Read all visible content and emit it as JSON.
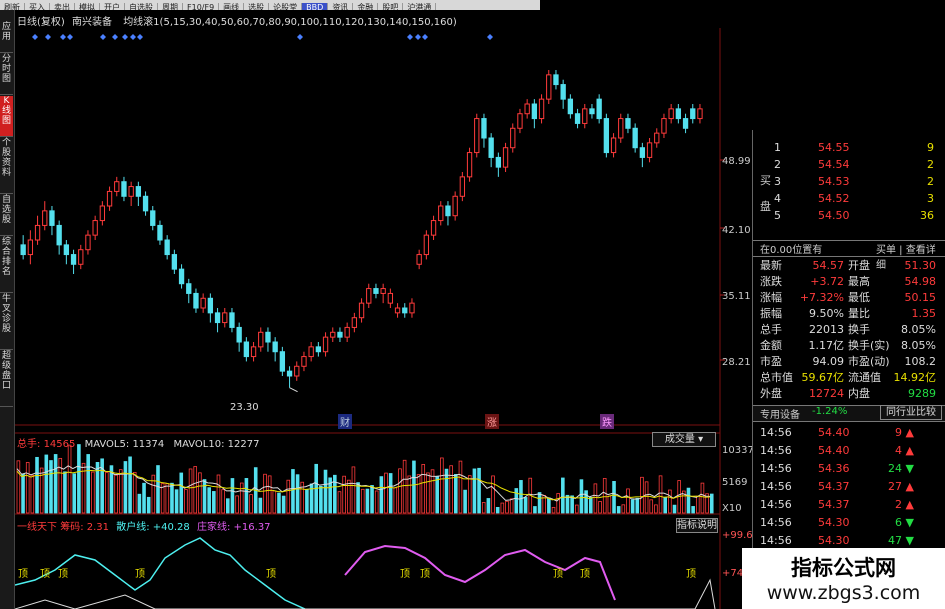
{
  "toolbar": {
    "items": [
      "刷新",
      "买入",
      "卖出",
      "模拟",
      "开户",
      "自选股",
      "周期",
      "F10/F9",
      "画线",
      "选股",
      "论股堂",
      "BBD",
      "资讯",
      "金融",
      "股吧",
      "沪港通"
    ],
    "highlight_index": 11
  },
  "sidebar": {
    "tabs": [
      "应用",
      "分时图",
      "K线图",
      "个股资料",
      "自选股",
      "综合排名",
      "牛叉诊股",
      "超级盘口"
    ],
    "active_index": 2
  },
  "chart_header": {
    "period_label": "日线(复权)",
    "stock_name": "南兴装备",
    "ma_label": "均线滚1(5,15,30,40,50,60,70,80,90,100,110,120,130,140,150,160)"
  },
  "price_axis": {
    "ticks": [
      "48.99",
      "42.10",
      "35.11",
      "28.21"
    ],
    "low_marker": "23.30"
  },
  "event_markers": [
    "财",
    "涨",
    "跌"
  ],
  "volume_header": {
    "total_label": "总手",
    "total_value": "14565",
    "mavol5_label": "MAVOL5",
    "mavol5_value": "11374",
    "mavol10_label": "MAVOL10",
    "mavol10_value": "12277",
    "dropdown": "成交量",
    "axis_ticks": [
      "10337",
      "5169",
      "X10"
    ]
  },
  "indicator_header": {
    "name": "一线天下",
    "chips_label": "筹码",
    "chips_value": "2.31",
    "retail_label": "散户线",
    "retail_value": "+40.28",
    "banker_label": "庄家线",
    "banker_value": "+16.37",
    "explain_button": "指标说明",
    "axis_ticks": [
      "+99.67",
      "+74.9"
    ],
    "signal_text": "顶"
  },
  "order_book": {
    "side_label_top": "买",
    "side_label_bottom": "盘",
    "rows": [
      {
        "level": "1",
        "price": "54.55",
        "vol": "9"
      },
      {
        "level": "2",
        "price": "54.54",
        "vol": "2"
      },
      {
        "level": "3",
        "price": "54.53",
        "vol": "2"
      },
      {
        "level": "4",
        "price": "54.52",
        "vol": "3"
      },
      {
        "level": "5",
        "price": "54.50",
        "vol": "36"
      }
    ]
  },
  "position_bar": {
    "position_text": "在0.00位置有",
    "buy_sell_link": "买单 | 查看详细"
  },
  "quote": {
    "rows": [
      {
        "l1": "最新",
        "v1": "54.57",
        "l2": "开盘",
        "v2": "51.30"
      },
      {
        "l1": "涨跌",
        "v1": "+3.72",
        "l2": "最高",
        "v2": "54.98"
      },
      {
        "l1": "涨幅",
        "v1": "+7.32%",
        "l2": "最低",
        "v2": "50.15"
      },
      {
        "l1": "振幅",
        "v1": "9.50%",
        "l2": "量比",
        "v2": "1.35"
      },
      {
        "l1": "总手",
        "v1": "22013",
        "l2": "换手",
        "v2": "8.05%"
      },
      {
        "l1": "金额",
        "v1": "1.17亿",
        "l2": "换手(实)",
        "v2": "8.05%"
      },
      {
        "l1": "市盈",
        "v1": "94.09",
        "l2": "市盈(动)",
        "v2": "108.2"
      },
      {
        "l1": "总市值",
        "v1": "59.67亿",
        "l2": "流通值",
        "v2": "14.92亿"
      },
      {
        "l1": "外盘",
        "v1": "12724",
        "l2": "内盘",
        "v2": "9289"
      }
    ]
  },
  "industry_bar": {
    "label": "专用设备",
    "change": "-1.24%",
    "button": "同行业比较"
  },
  "ticks": [
    {
      "time": "14:56",
      "price": "54.40",
      "vol": "9",
      "dir": "up"
    },
    {
      "time": "14:56",
      "price": "54.40",
      "vol": "4",
      "dir": "up"
    },
    {
      "time": "14:56",
      "price": "54.36",
      "vol": "24",
      "dir": "down"
    },
    {
      "time": "14:56",
      "price": "54.37",
      "vol": "27",
      "dir": "up"
    },
    {
      "time": "14:56",
      "price": "54.37",
      "vol": "2",
      "dir": "up"
    },
    {
      "time": "14:56",
      "price": "54.30",
      "vol": "6",
      "dir": "down"
    },
    {
      "time": "14:56",
      "price": "54.30",
      "vol": "47",
      "dir": "down"
    }
  ],
  "watermark": {
    "title": "指标公式网",
    "url": "www.zbgs3.com"
  },
  "chart_data": {
    "type": "candlestick",
    "y_range": [
      21,
      56
    ],
    "candles": [
      [
        38,
        37,
        39,
        36.5
      ],
      [
        37,
        38.5,
        39.5,
        36
      ],
      [
        38.5,
        40,
        41,
        38
      ],
      [
        40,
        41.5,
        42.5,
        39.5
      ],
      [
        41.5,
        40,
        42,
        39
      ],
      [
        40,
        38,
        40.5,
        37
      ],
      [
        38,
        37,
        38.5,
        36
      ],
      [
        37,
        36,
        37.5,
        35
      ],
      [
        36,
        37.5,
        38,
        35.5
      ],
      [
        37.5,
        39,
        39.5,
        37
      ],
      [
        39,
        40.5,
        41,
        38.5
      ],
      [
        40.5,
        42,
        42.5,
        40
      ],
      [
        42,
        43.5,
        44,
        41.5
      ],
      [
        43.5,
        44.5,
        45,
        43
      ],
      [
        44.5,
        43,
        45,
        42.5
      ],
      [
        43,
        44,
        44.5,
        42
      ],
      [
        44,
        43,
        44.5,
        42
      ],
      [
        43,
        41.5,
        43.5,
        41
      ],
      [
        41.5,
        40,
        42,
        39.5
      ],
      [
        40,
        38.5,
        40.5,
        38
      ],
      [
        38.5,
        37,
        39,
        36.5
      ],
      [
        37,
        35.5,
        37.5,
        35
      ],
      [
        35.5,
        34,
        36,
        33.5
      ],
      [
        34,
        33,
        34.5,
        32
      ],
      [
        33,
        31.5,
        33.5,
        31
      ],
      [
        31.5,
        32.5,
        33,
        31
      ],
      [
        32.5,
        31,
        33,
        30
      ],
      [
        31,
        30,
        31.5,
        29
      ],
      [
        30,
        31,
        31.5,
        29.5
      ],
      [
        31,
        29.5,
        31.5,
        29
      ],
      [
        29.5,
        28,
        30,
        27
      ],
      [
        28,
        26.5,
        28.5,
        26
      ],
      [
        26.5,
        27.5,
        28,
        26
      ],
      [
        27.5,
        29,
        29.5,
        27
      ],
      [
        29,
        28,
        29.5,
        27
      ],
      [
        28,
        27,
        28.5,
        26
      ],
      [
        27,
        25,
        27.5,
        24.5
      ],
      [
        25,
        24.5,
        25.5,
        23.3
      ],
      [
        24.5,
        25.5,
        26,
        24
      ],
      [
        25.5,
        26.5,
        27,
        25
      ],
      [
        26.5,
        27.5,
        28,
        26
      ],
      [
        27.5,
        27,
        28,
        26.5
      ],
      [
        27,
        28.5,
        29,
        26.5
      ],
      [
        28.5,
        29,
        29.5,
        28
      ],
      [
        29,
        28.5,
        29.5,
        28
      ],
      [
        28.5,
        29.5,
        30,
        28
      ],
      [
        29.5,
        30.5,
        31,
        29
      ],
      [
        30.5,
        32,
        32.5,
        30
      ],
      [
        32,
        33.5,
        34,
        31.5
      ],
      [
        33.5,
        33,
        34,
        32.5
      ],
      [
        33,
        33.5,
        34,
        32
      ],
      [
        32,
        33,
        33.5,
        31.5
      ],
      [
        31,
        31.5,
        32,
        30.5
      ],
      [
        31.5,
        31,
        32,
        30.5
      ],
      [
        31,
        32,
        32.5,
        30.5
      ],
      [
        36,
        37,
        37.5,
        35.5
      ],
      [
        37,
        39,
        39.5,
        36.5
      ],
      [
        39,
        40.5,
        41,
        38.5
      ],
      [
        40.5,
        42,
        42.5,
        40
      ],
      [
        42,
        41,
        42.5,
        40
      ],
      [
        41,
        43,
        43.5,
        40.5
      ],
      [
        43,
        45,
        45.5,
        42.5
      ],
      [
        45,
        47.5,
        48,
        44.5
      ],
      [
        47.5,
        51,
        51.5,
        47
      ],
      [
        51,
        49,
        51.5,
        48
      ],
      [
        49,
        47,
        49.5,
        46
      ],
      [
        47,
        46,
        47.5,
        45
      ],
      [
        46,
        48,
        48.5,
        45.5
      ],
      [
        48,
        50,
        50.5,
        47.5
      ],
      [
        50,
        51.5,
        52,
        49.5
      ],
      [
        51.5,
        52.5,
        53,
        51
      ],
      [
        52.5,
        51,
        53,
        50
      ],
      [
        51,
        53,
        53.5,
        50.5
      ],
      [
        53,
        55.5,
        56,
        52.5
      ],
      [
        55.5,
        54.5,
        56,
        54
      ],
      [
        54.5,
        53,
        55,
        52
      ],
      [
        53,
        51.5,
        53.5,
        51
      ],
      [
        51.5,
        50.5,
        52,
        50
      ],
      [
        50.5,
        52,
        52.5,
        50
      ],
      [
        52,
        51.5,
        52.5,
        51
      ],
      [
        53,
        51,
        53.5,
        50.5
      ],
      [
        51,
        47.5,
        51.5,
        47
      ],
      [
        47.5,
        49,
        49.5,
        47
      ],
      [
        49,
        51,
        51.5,
        48.5
      ],
      [
        51,
        50,
        51.5,
        49.5
      ],
      [
        50,
        48,
        50.5,
        47.5
      ],
      [
        48,
        47,
        48.5,
        46
      ],
      [
        47,
        48.5,
        49,
        46.5
      ],
      [
        48.5,
        49.5,
        50,
        48
      ],
      [
        49.5,
        51,
        51.5,
        49
      ],
      [
        51,
        52,
        52.5,
        50.5
      ],
      [
        52,
        51,
        52.5,
        50.5
      ],
      [
        51,
        50,
        51.5,
        49.5
      ],
      [
        52,
        51,
        52.5,
        50.5
      ],
      [
        51,
        52,
        52.5,
        50.5
      ]
    ]
  }
}
